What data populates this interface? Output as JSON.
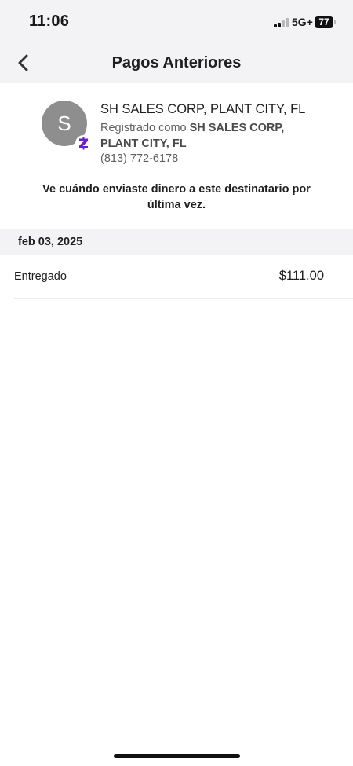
{
  "status_bar": {
    "time": "11:06",
    "network": "5G+",
    "battery": "77",
    "signal_bars_active": 2,
    "signal_bars_total": 4
  },
  "nav": {
    "title": "Pagos Anteriores",
    "back_icon": "chevron-left-icon"
  },
  "recipient": {
    "avatar_initial": "S",
    "avatar_color": "#8e8e8e",
    "badge_icon": "zelle-icon",
    "badge_color": "#6d1ed4",
    "name": "SH SALES CORP, PLANT CITY, FL",
    "registered_prefix": "Registrado como ",
    "registered_name": "SH SALES CORP, PLANT CITY, FL",
    "phone": "(813) 772-6178"
  },
  "info_text": "Ve cuándo enviaste dinero a este destinatario por última vez.",
  "payments": {
    "date": "feb 03, 2025",
    "items": [
      {
        "status": "Entregado",
        "amount": "$111.00"
      }
    ]
  }
}
